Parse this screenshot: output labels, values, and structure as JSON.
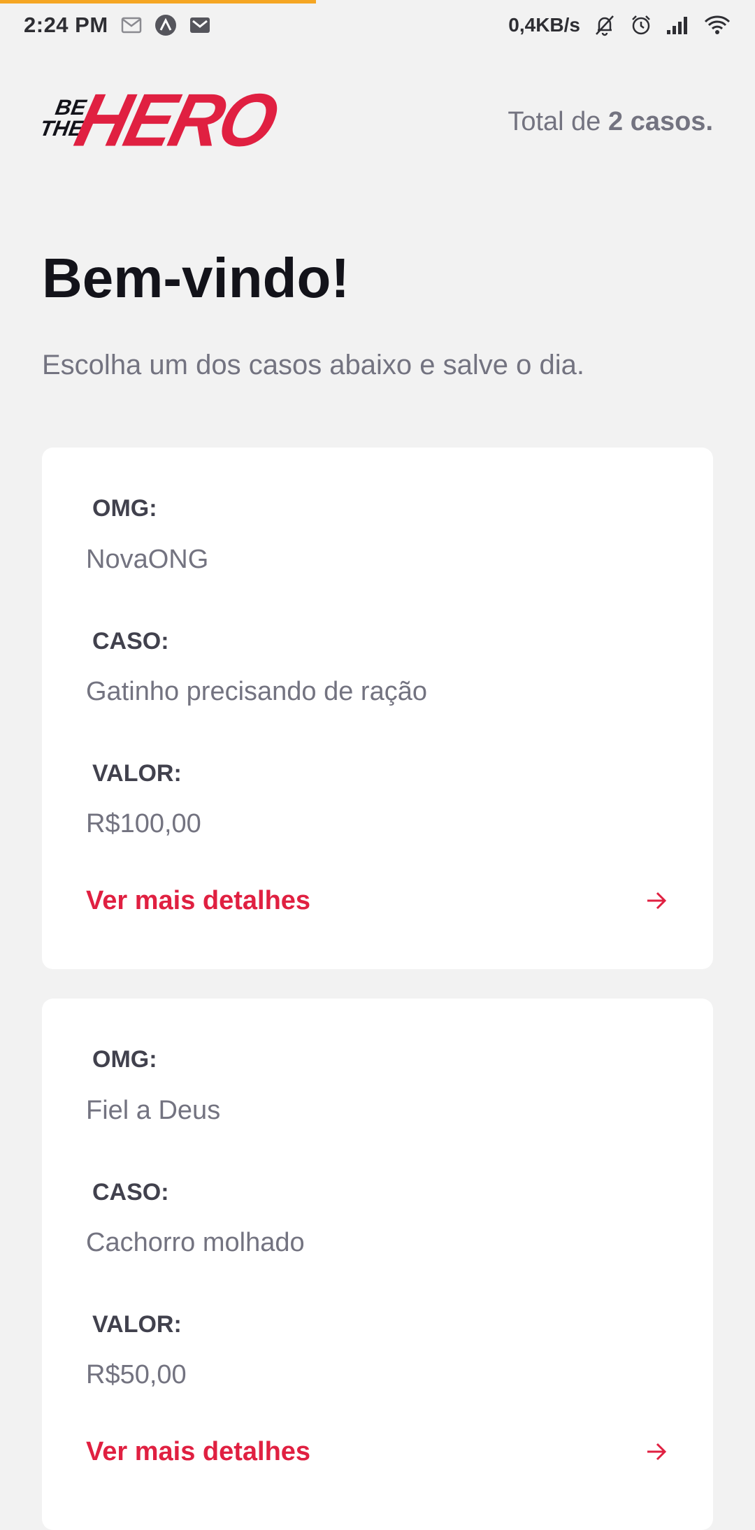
{
  "status_bar": {
    "time": "2:24 PM",
    "network_speed": "0,4KB/s",
    "icons": [
      "mail-outline-icon",
      "app-a-icon",
      "gmail-icon",
      "bell-off-icon",
      "alarm-icon",
      "signal-icon",
      "wifi-icon"
    ]
  },
  "header": {
    "logo": {
      "be": "BE",
      "the": "THE",
      "hero": "HERO"
    },
    "total_prefix": "Total de ",
    "total_count": "2 casos."
  },
  "welcome": {
    "title": "Bem-vindo!",
    "subtitle": "Escolha um dos casos abaixo e salve o dia."
  },
  "labels": {
    "ong": "OMG:",
    "caso": "CASO:",
    "valor": "VALOR:",
    "details": "Ver mais detalhes"
  },
  "incidents": [
    {
      "ong": "NovaONG",
      "caso": "Gatinho precisando de ração",
      "valor": "R$100,00"
    },
    {
      "ong": "Fiel a Deus",
      "caso": "Cachorro molhado",
      "valor": "R$50,00"
    }
  ],
  "colors": {
    "brand": "#E02041",
    "background": "#F2F2F2",
    "card": "#FFFFFF",
    "title": "#13131A",
    "label": "#41414D",
    "text": "#737380"
  }
}
